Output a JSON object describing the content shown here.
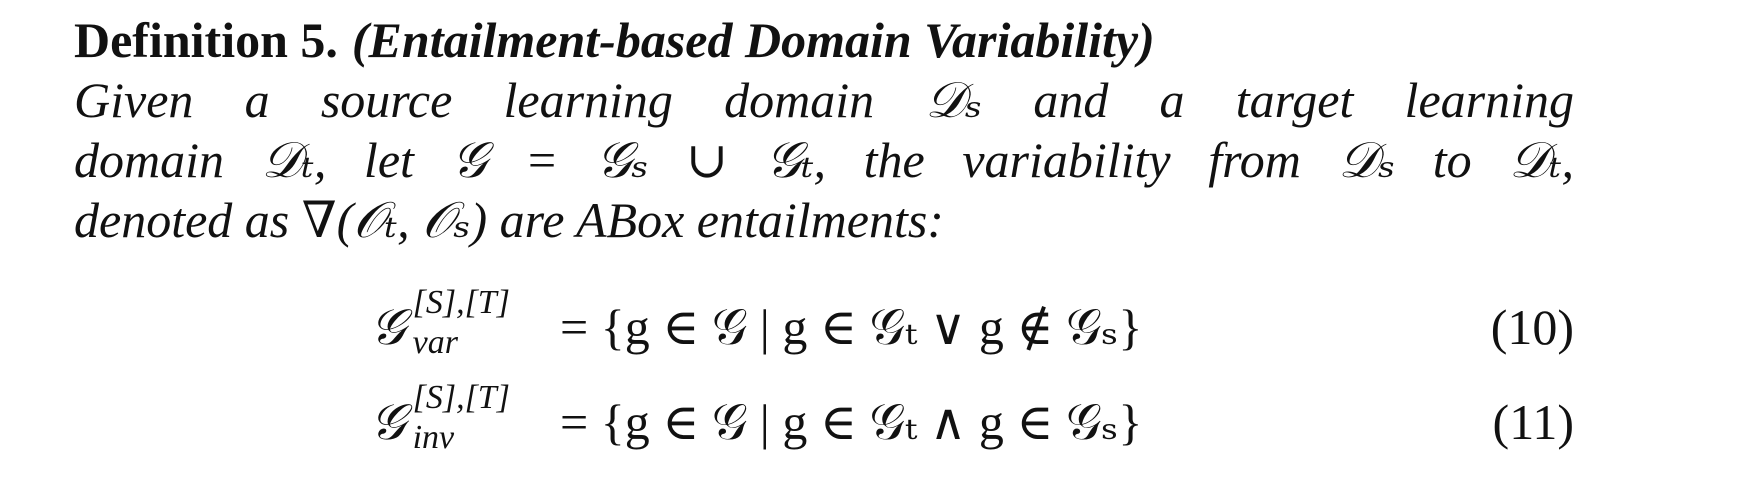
{
  "definition": {
    "label": "Definition 5.",
    "title": "(Entailment-based Domain Variability)",
    "lines": [
      "Given a source learning domain 𝒟ₛ and a target learning",
      "domain 𝒟ₜ, let 𝒢 = 𝒢ₛ ∪ 𝒢ₜ, the variability from 𝒟ₛ to 𝒟ₜ,",
      "denoted as ∇(𝒪ₜ, 𝒪ₛ) are ABox entailments:"
    ]
  },
  "equations": [
    {
      "symbol": "𝒢",
      "superscript": "[S],[T]",
      "subscript": "var",
      "rhs": "= {g ∈ 𝒢 | g ∈ 𝒢ₜ  ∨ g ∉ 𝒢ₛ}",
      "number": "(10)"
    },
    {
      "symbol": "𝒢",
      "superscript": "[S],[T]",
      "subscript": "inv",
      "rhs": "= {g ∈ 𝒢 | g ∈ 𝒢ₜ  ∧ g ∈ 𝒢ₛ}",
      "number": "(11)"
    }
  ]
}
